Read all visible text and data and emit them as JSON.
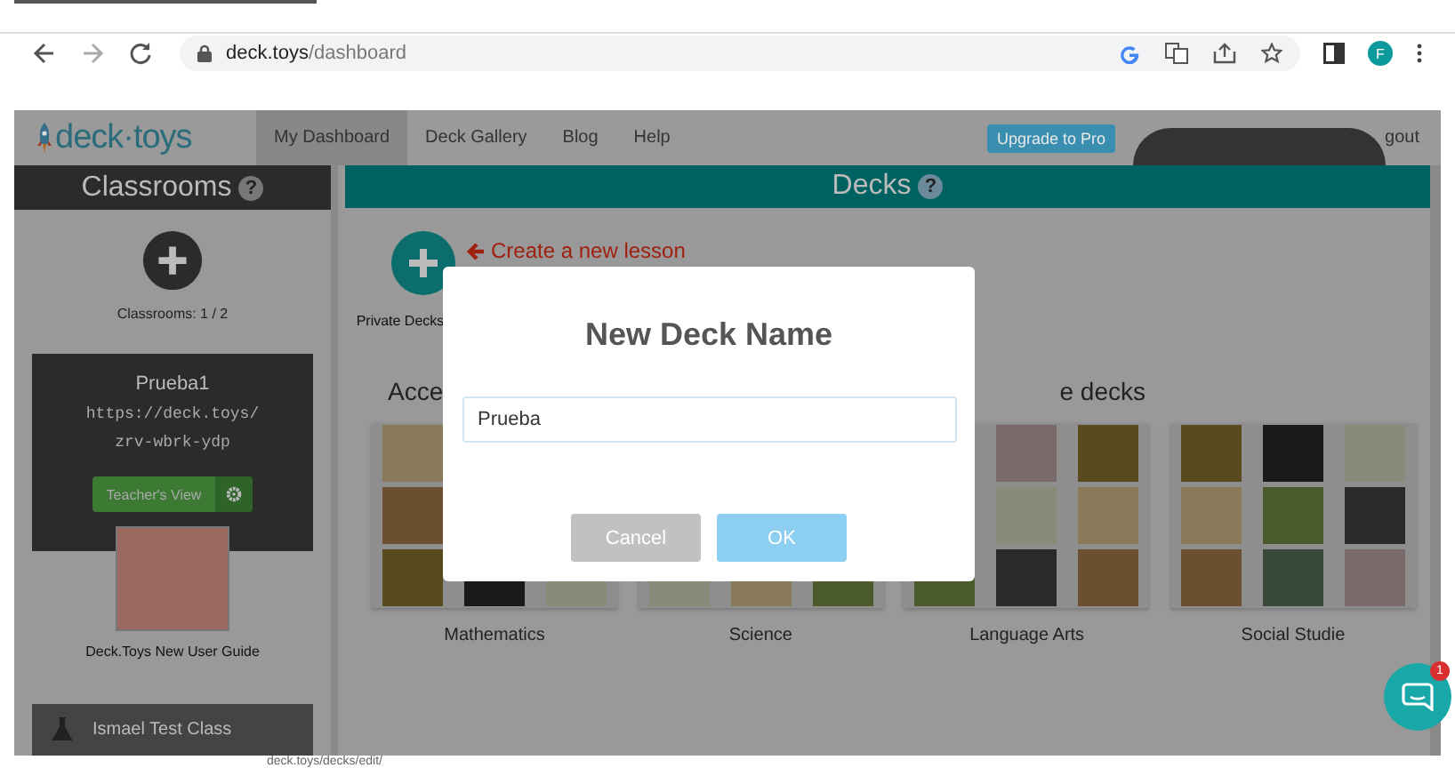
{
  "browser": {
    "url_host": "deck.toys",
    "url_path": "/dashboard",
    "profile_initial": "F"
  },
  "app": {
    "logo": "deck·toys",
    "nav": [
      {
        "label": "My Dashboard",
        "selected": true
      },
      {
        "label": "Deck Gallery",
        "selected": false
      },
      {
        "label": "Blog",
        "selected": false
      },
      {
        "label": "Help",
        "selected": false
      }
    ],
    "upgrade_button": "Upgrade to Pro",
    "account_link": "gout"
  },
  "sidebar": {
    "title": "Classrooms",
    "help": "?",
    "count": "Classrooms: 1 / 2",
    "classroom": {
      "name": "Prueba1",
      "link_lines": [
        "https://deck.toys/",
        "zrv-wbrk-ydp"
      ],
      "teacher_button": "Teacher's View"
    },
    "guide": {
      "label": "Deck.Toys New User Guide"
    },
    "next_classroom": "Ismael Test Class"
  },
  "main": {
    "title": "Decks",
    "help": "?",
    "create_link": "Create a new lesson",
    "private_label": "Private Decks",
    "heading_left": "Acce",
    "heading_right": "e decks",
    "categories": [
      {
        "label": "Mathematics"
      },
      {
        "label": "Science"
      },
      {
        "label": "Language Arts"
      },
      {
        "label": "Social Studie"
      }
    ]
  },
  "chat": {
    "badge": "1"
  },
  "dialog": {
    "title": "New Deck Name",
    "value": "Prueba ",
    "buttons": [
      {
        "label": "Cancel",
        "kind": "secondary"
      },
      {
        "label": "OK",
        "kind": "primary"
      }
    ]
  },
  "bottom_bar": {
    "url": "deck.toys/decks/edit/"
  }
}
